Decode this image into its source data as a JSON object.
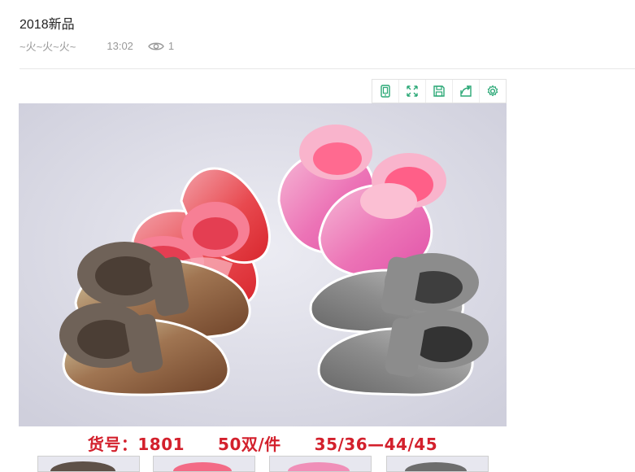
{
  "post": {
    "title": "2018新品",
    "author": "~火~火~火~",
    "time": "13:02",
    "views": "1"
  },
  "toolbar": {
    "buttons": [
      {
        "icon": "phone-view-icon"
      },
      {
        "icon": "fullscreen-icon"
      },
      {
        "icon": "save-icon"
      },
      {
        "icon": "share-icon"
      },
      {
        "icon": "settings-icon"
      }
    ],
    "accent_color": "#2aa876"
  },
  "image": {
    "caption": "货号：1801　　50双/件　　35/36—44/45",
    "caption_color": "#d3202c"
  }
}
